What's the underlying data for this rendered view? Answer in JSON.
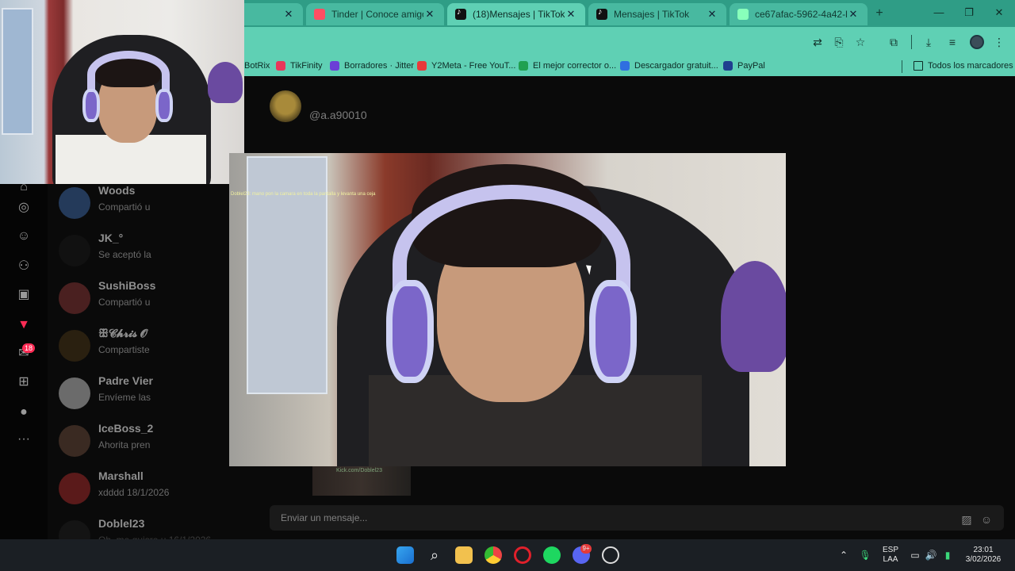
{
  "browser": {
    "tabs": [
      {
        "title": "",
        "active": false,
        "favicon": "none"
      },
      {
        "title": "Tinder | Conoce amigos y",
        "active": false,
        "favicon": "tinder-icon"
      },
      {
        "title": "(18)Mensajes | TikTok",
        "active": true,
        "favicon": "tiktok-icon"
      },
      {
        "title": "Mensajes | TikTok",
        "active": false,
        "favicon": "tiktok-icon"
      },
      {
        "title": "ce67afac-5962-4a42-b6a",
        "active": false,
        "favicon": "globe-icon"
      }
    ],
    "new_tab_label": "+",
    "window_controls": {
      "minimize": "—",
      "restore": "❐",
      "close": "✕"
    },
    "bookmarks": [
      {
        "label": "BotRix",
        "icon": "botrix-icon"
      },
      {
        "label": "TikFinity",
        "icon": "tikfinity-icon"
      },
      {
        "label": "Borradores · Jitter",
        "icon": "jitter-icon"
      },
      {
        "label": "Y2Meta - Free YouT...",
        "icon": "y2meta-icon"
      },
      {
        "label": "El mejor corrector o...",
        "icon": "corrector-icon"
      },
      {
        "label": "Descargador gratuit...",
        "icon": "download-icon"
      },
      {
        "label": "PayPal",
        "icon": "paypal-icon"
      }
    ],
    "all_bookmarks_label": "Todos los marcadores"
  },
  "tiktok": {
    "rail_badge": "18",
    "chat_header": {
      "username": "@a.a90010"
    },
    "conversations": [
      {
        "name": "Woods",
        "preview": "Compartió u"
      },
      {
        "name": "JK_°",
        "preview": "Se aceptó la"
      },
      {
        "name": "SushiBoss",
        "preview": "Compartió u"
      },
      {
        "name": "ꕥ𝓒𝓱𝓻𝓲𝓼 𝓞",
        "preview": "Compartiste"
      },
      {
        "name": "Padre Vier",
        "preview": "Envíeme las"
      },
      {
        "name": "IceBoss_2",
        "preview": "Ahorita pren"
      },
      {
        "name": "Marshall",
        "preview": "xdddd 18/1/2026"
      },
      {
        "name": "Doblel23",
        "preview": "Oh, me quisre u 16/1/2026"
      }
    ],
    "message_input": {
      "placeholder": "Enviar un mensaje..."
    },
    "stream_chat_overlay": "Doblel23: mano pon la camara en toda la pantalla y levanta una ceja",
    "bottom_thumb_label": "Kick.com/Doblel23"
  },
  "taskbar": {
    "language": "ESP",
    "layout": "LAA",
    "time": "23:01",
    "date": "3/02/2026",
    "discord_badge": "9+"
  }
}
